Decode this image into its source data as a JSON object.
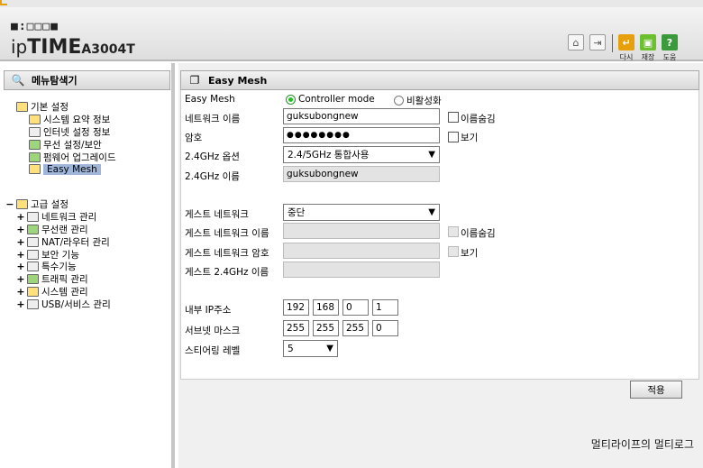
{
  "header": {
    "logo_dots": "■:□□□■",
    "logo_ip": "ip",
    "logo_time": "TIME",
    "model": "A3004T",
    "buttons": [
      {
        "icon": "home-icon",
        "label": ""
      },
      {
        "icon": "logout-icon",
        "label": ""
      },
      {
        "icon": "restart-icon",
        "label": "다시",
        "color": "#e5a00b"
      },
      {
        "icon": "save-icon",
        "label": "재장",
        "color": "#6cbf2f"
      },
      {
        "icon": "help-icon",
        "label": "도움",
        "color": "#3b9a3b"
      }
    ]
  },
  "sidebar": {
    "title": "메뉴탐색기",
    "basic": {
      "label": "기본 설정",
      "items": [
        "시스템 요약 정보",
        "인터넷 설정 정보",
        "무선 설정/보안",
        "펌웨어 업그레이드",
        "Easy Mesh"
      ]
    },
    "advanced": {
      "toggle": "−",
      "label": "고급 설정",
      "items": [
        "네트워크 관리",
        "무선랜 관리",
        "NAT/라우터 관리",
        "보안 기능",
        "특수기능",
        "트래픽 관리",
        "시스템 관리",
        "USB/서비스 관리"
      ]
    }
  },
  "main": {
    "title": "Easy Mesh",
    "form": {
      "mode_label": "Easy Mesh",
      "mode_options": [
        "Controller mode",
        "비활성화"
      ],
      "mode_selected": "Controller mode",
      "net_name_label": "네트워크 이름",
      "net_name_value": "guksubongnew",
      "hide_name_label": "이름숨김",
      "password_label": "암호",
      "password_value": "●●●●●●●●",
      "show_label": "보기",
      "ghz_opt_label": "2.4GHz 옵션",
      "ghz_opt_value": "2.4/5GHz 통합사용",
      "ghz_name_label": "2.4GHz 이름",
      "ghz_name_value": "guksubongnew",
      "guest_label": "게스트 네트워크",
      "guest_value": "중단",
      "guest_name_label": "게스트 네트워크 이름",
      "guest_hide_label": "이름숨김",
      "guest_pw_label": "게스트 네트워크 암호",
      "guest_show_label": "보기",
      "guest_ghz_label": "게스트 2.4GHz 이름",
      "ip_label": "내부 IP주소",
      "ip": [
        "192",
        "168",
        "0",
        "1"
      ],
      "mask_label": "서브넷 마스크",
      "mask": [
        "255",
        "255",
        "255",
        "0"
      ],
      "steer_label": "스티어링 레벨",
      "steer_value": "5",
      "apply_label": "적용"
    }
  },
  "watermark": "멀티라이프의 멀티로그"
}
